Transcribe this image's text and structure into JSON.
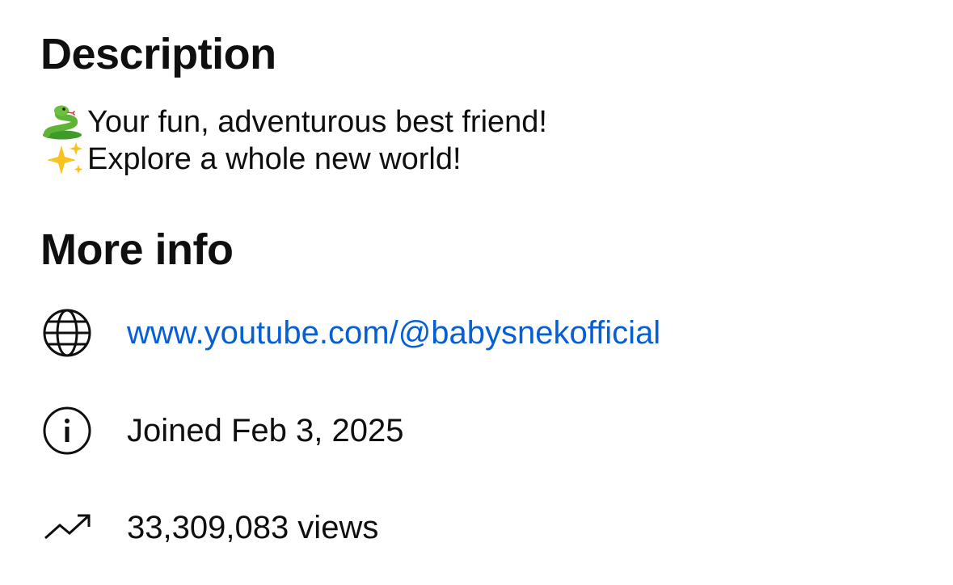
{
  "description": {
    "heading": "Description",
    "lines": [
      {
        "emoji": "snake-emoji",
        "text": "Your fun, adventurous best friend!"
      },
      {
        "emoji": "sparkles-emoji",
        "text": "Explore a whole new world!"
      }
    ]
  },
  "more_info": {
    "heading": "More info",
    "link": {
      "icon": "globe-icon",
      "text": "www.youtube.com/@babysnekofficial",
      "color": "#065fd4"
    },
    "joined": {
      "icon": "info-icon",
      "text": "Joined Feb 3, 2025"
    },
    "views": {
      "icon": "trending-up-icon",
      "text": "33,309,083 views"
    }
  }
}
